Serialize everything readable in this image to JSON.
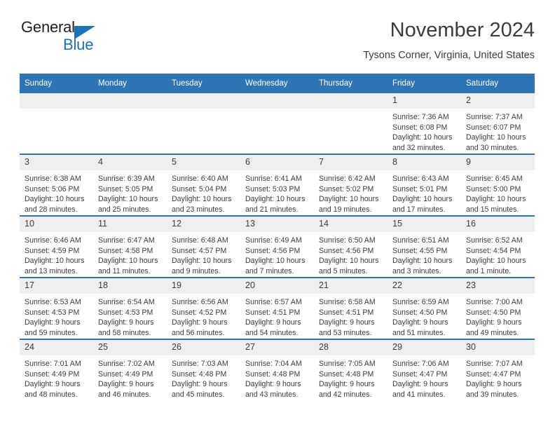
{
  "brand": {
    "name_part1": "General",
    "name_part2": "Blue",
    "accent_color": "#1b72b8",
    "triangle_icon": "brand-triangle-icon"
  },
  "header": {
    "title": "November 2024",
    "subtitle": "Tysons Corner, Virginia, United States",
    "header_bar_color": "#2e75b6",
    "daynum_bg_color": "#efefef"
  },
  "calendar": {
    "weekday_headers": [
      "Sunday",
      "Monday",
      "Tuesday",
      "Wednesday",
      "Thursday",
      "Friday",
      "Saturday"
    ],
    "weeks": [
      [
        {
          "day": "",
          "sunrise": "",
          "sunset": "",
          "daylight": ""
        },
        {
          "day": "",
          "sunrise": "",
          "sunset": "",
          "daylight": ""
        },
        {
          "day": "",
          "sunrise": "",
          "sunset": "",
          "daylight": ""
        },
        {
          "day": "",
          "sunrise": "",
          "sunset": "",
          "daylight": ""
        },
        {
          "day": "",
          "sunrise": "",
          "sunset": "",
          "daylight": ""
        },
        {
          "day": "1",
          "sunrise": "Sunrise: 7:36 AM",
          "sunset": "Sunset: 6:08 PM",
          "daylight": "Daylight: 10 hours and 32 minutes."
        },
        {
          "day": "2",
          "sunrise": "Sunrise: 7:37 AM",
          "sunset": "Sunset: 6:07 PM",
          "daylight": "Daylight: 10 hours and 30 minutes."
        }
      ],
      [
        {
          "day": "3",
          "sunrise": "Sunrise: 6:38 AM",
          "sunset": "Sunset: 5:06 PM",
          "daylight": "Daylight: 10 hours and 28 minutes."
        },
        {
          "day": "4",
          "sunrise": "Sunrise: 6:39 AM",
          "sunset": "Sunset: 5:05 PM",
          "daylight": "Daylight: 10 hours and 25 minutes."
        },
        {
          "day": "5",
          "sunrise": "Sunrise: 6:40 AM",
          "sunset": "Sunset: 5:04 PM",
          "daylight": "Daylight: 10 hours and 23 minutes."
        },
        {
          "day": "6",
          "sunrise": "Sunrise: 6:41 AM",
          "sunset": "Sunset: 5:03 PM",
          "daylight": "Daylight: 10 hours and 21 minutes."
        },
        {
          "day": "7",
          "sunrise": "Sunrise: 6:42 AM",
          "sunset": "Sunset: 5:02 PM",
          "daylight": "Daylight: 10 hours and 19 minutes."
        },
        {
          "day": "8",
          "sunrise": "Sunrise: 6:43 AM",
          "sunset": "Sunset: 5:01 PM",
          "daylight": "Daylight: 10 hours and 17 minutes."
        },
        {
          "day": "9",
          "sunrise": "Sunrise: 6:45 AM",
          "sunset": "Sunset: 5:00 PM",
          "daylight": "Daylight: 10 hours and 15 minutes."
        }
      ],
      [
        {
          "day": "10",
          "sunrise": "Sunrise: 6:46 AM",
          "sunset": "Sunset: 4:59 PM",
          "daylight": "Daylight: 10 hours and 13 minutes."
        },
        {
          "day": "11",
          "sunrise": "Sunrise: 6:47 AM",
          "sunset": "Sunset: 4:58 PM",
          "daylight": "Daylight: 10 hours and 11 minutes."
        },
        {
          "day": "12",
          "sunrise": "Sunrise: 6:48 AM",
          "sunset": "Sunset: 4:57 PM",
          "daylight": "Daylight: 10 hours and 9 minutes."
        },
        {
          "day": "13",
          "sunrise": "Sunrise: 6:49 AM",
          "sunset": "Sunset: 4:56 PM",
          "daylight": "Daylight: 10 hours and 7 minutes."
        },
        {
          "day": "14",
          "sunrise": "Sunrise: 6:50 AM",
          "sunset": "Sunset: 4:56 PM",
          "daylight": "Daylight: 10 hours and 5 minutes."
        },
        {
          "day": "15",
          "sunrise": "Sunrise: 6:51 AM",
          "sunset": "Sunset: 4:55 PM",
          "daylight": "Daylight: 10 hours and 3 minutes."
        },
        {
          "day": "16",
          "sunrise": "Sunrise: 6:52 AM",
          "sunset": "Sunset: 4:54 PM",
          "daylight": "Daylight: 10 hours and 1 minute."
        }
      ],
      [
        {
          "day": "17",
          "sunrise": "Sunrise: 6:53 AM",
          "sunset": "Sunset: 4:53 PM",
          "daylight": "Daylight: 9 hours and 59 minutes."
        },
        {
          "day": "18",
          "sunrise": "Sunrise: 6:54 AM",
          "sunset": "Sunset: 4:53 PM",
          "daylight": "Daylight: 9 hours and 58 minutes."
        },
        {
          "day": "19",
          "sunrise": "Sunrise: 6:56 AM",
          "sunset": "Sunset: 4:52 PM",
          "daylight": "Daylight: 9 hours and 56 minutes."
        },
        {
          "day": "20",
          "sunrise": "Sunrise: 6:57 AM",
          "sunset": "Sunset: 4:51 PM",
          "daylight": "Daylight: 9 hours and 54 minutes."
        },
        {
          "day": "21",
          "sunrise": "Sunrise: 6:58 AM",
          "sunset": "Sunset: 4:51 PM",
          "daylight": "Daylight: 9 hours and 53 minutes."
        },
        {
          "day": "22",
          "sunrise": "Sunrise: 6:59 AM",
          "sunset": "Sunset: 4:50 PM",
          "daylight": "Daylight: 9 hours and 51 minutes."
        },
        {
          "day": "23",
          "sunrise": "Sunrise: 7:00 AM",
          "sunset": "Sunset: 4:50 PM",
          "daylight": "Daylight: 9 hours and 49 minutes."
        }
      ],
      [
        {
          "day": "24",
          "sunrise": "Sunrise: 7:01 AM",
          "sunset": "Sunset: 4:49 PM",
          "daylight": "Daylight: 9 hours and 48 minutes."
        },
        {
          "day": "25",
          "sunrise": "Sunrise: 7:02 AM",
          "sunset": "Sunset: 4:49 PM",
          "daylight": "Daylight: 9 hours and 46 minutes."
        },
        {
          "day": "26",
          "sunrise": "Sunrise: 7:03 AM",
          "sunset": "Sunset: 4:48 PM",
          "daylight": "Daylight: 9 hours and 45 minutes."
        },
        {
          "day": "27",
          "sunrise": "Sunrise: 7:04 AM",
          "sunset": "Sunset: 4:48 PM",
          "daylight": "Daylight: 9 hours and 43 minutes."
        },
        {
          "day": "28",
          "sunrise": "Sunrise: 7:05 AM",
          "sunset": "Sunset: 4:48 PM",
          "daylight": "Daylight: 9 hours and 42 minutes."
        },
        {
          "day": "29",
          "sunrise": "Sunrise: 7:06 AM",
          "sunset": "Sunset: 4:47 PM",
          "daylight": "Daylight: 9 hours and 41 minutes."
        },
        {
          "day": "30",
          "sunrise": "Sunrise: 7:07 AM",
          "sunset": "Sunset: 4:47 PM",
          "daylight": "Daylight: 9 hours and 39 minutes."
        }
      ]
    ]
  }
}
